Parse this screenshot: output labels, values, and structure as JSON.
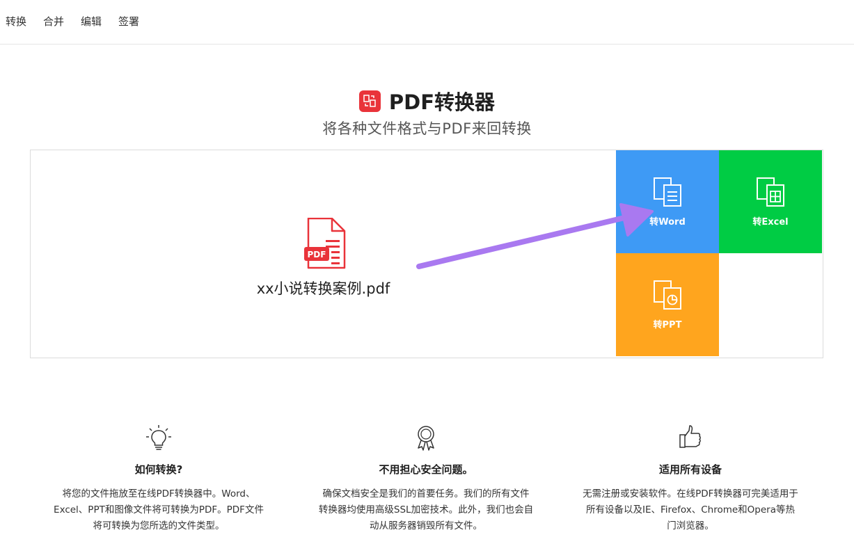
{
  "nav": {
    "items": [
      "转换",
      "合并",
      "编辑",
      "签署"
    ]
  },
  "hero": {
    "title": "PDF转换器",
    "subtitle": "将各种文件格式与PDF来回转换"
  },
  "file": {
    "name": "xx小说转换案例.pdf",
    "badge": "PDF"
  },
  "tiles": {
    "word": "转Word",
    "excel": "转Excel",
    "ppt": "转PPT"
  },
  "features": [
    {
      "icon": "lightbulb-icon",
      "title": "如何转换?",
      "text": "将您的文件拖放至在线PDF转换器中。Word、Excel、PPT和图像文件将可转换为PDF。PDF文件将可转换为您所选的文件类型。"
    },
    {
      "icon": "award-ribbon-icon",
      "title": "不用担心安全问题。",
      "text": "确保文档安全是我们的首要任务。我们的所有文件转换器均使用高级SSL加密技术。此外，我们也会自动从服务器销毁所有文件。"
    },
    {
      "icon": "thumbs-up-icon",
      "title": "适用所有设备",
      "text": "无需注册或安装软件。在线PDF转换器可完美适用于所有设备以及IE、Firefox、Chrome和Opera等热门浏览器。"
    }
  ],
  "colors": {
    "brand_red": "#e9333a",
    "word_blue": "#3e9af5",
    "excel_green": "#00cc44",
    "ppt_orange": "#ffa51e",
    "annotation_arrow": "#a979f0"
  }
}
